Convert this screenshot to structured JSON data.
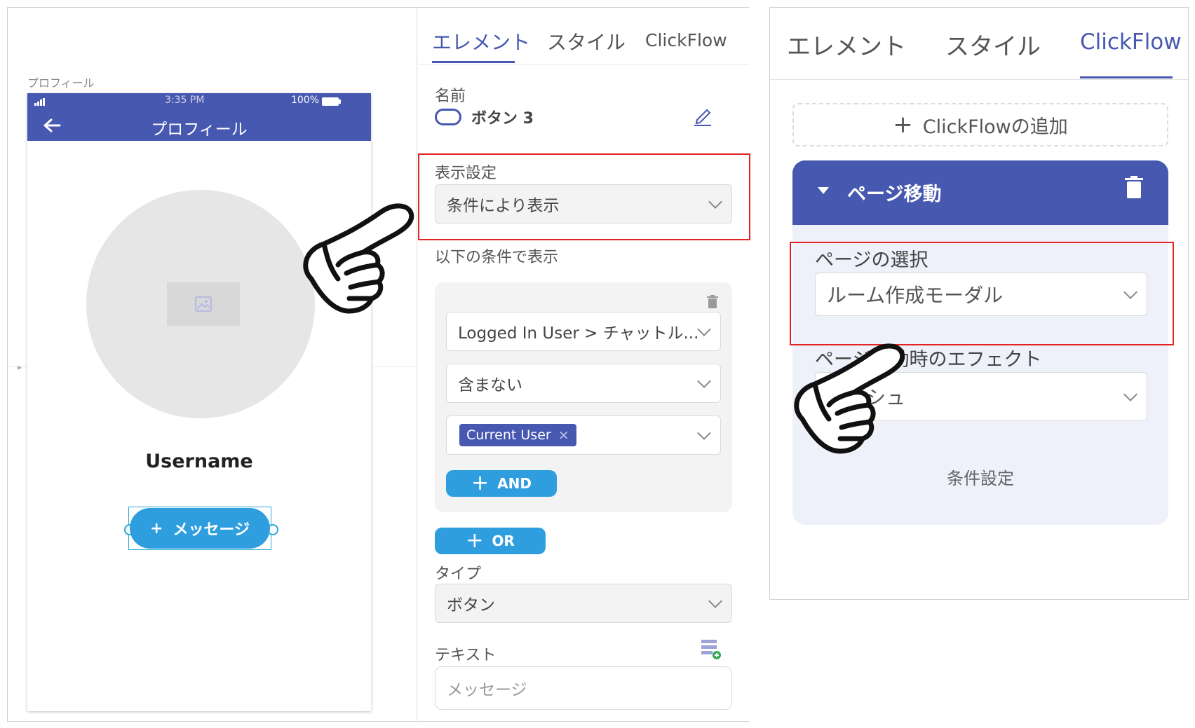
{
  "canvas": {
    "page_caption": "プロフィール",
    "status_bar": {
      "time": "3:35 PM",
      "battery": "100%"
    },
    "header": {
      "title": "プロフィール"
    },
    "username": "Username",
    "message_button": {
      "plus": "+",
      "label": "メッセージ"
    }
  },
  "properties": {
    "tabs": [
      "エレメント",
      "スタイル",
      "ClickFlow"
    ],
    "name_label": "名前",
    "name_value": "ボタン 3",
    "display_label": "表示設定",
    "display_value": "条件により表示",
    "condition_label": "以下の条件で表示",
    "condition": {
      "field": "Logged In User > チャットル...",
      "operator": "含まない",
      "tag": "Current User",
      "tag_remove": "×",
      "and_label": "AND"
    },
    "or_label": "OR",
    "type_label": "タイプ",
    "type_value": "ボタン",
    "text_label": "テキスト",
    "text_placeholder": "メッセージ"
  },
  "clickflow": {
    "tabs": [
      "エレメント",
      "スタイル",
      "ClickFlow"
    ],
    "add_label": "ClickFlowの追加",
    "flow_title": "ページ移動",
    "page_select_label": "ページの選択",
    "page_select_value": "ルーム作成モーダル",
    "effect_label": "ページ移動時のエフェクト",
    "effect_value": "プッシュ",
    "condition_settings": "条件設定"
  },
  "colors": {
    "brand": "#4758b0",
    "button_blue": "#2e9edf",
    "highlight": "#e02424"
  }
}
